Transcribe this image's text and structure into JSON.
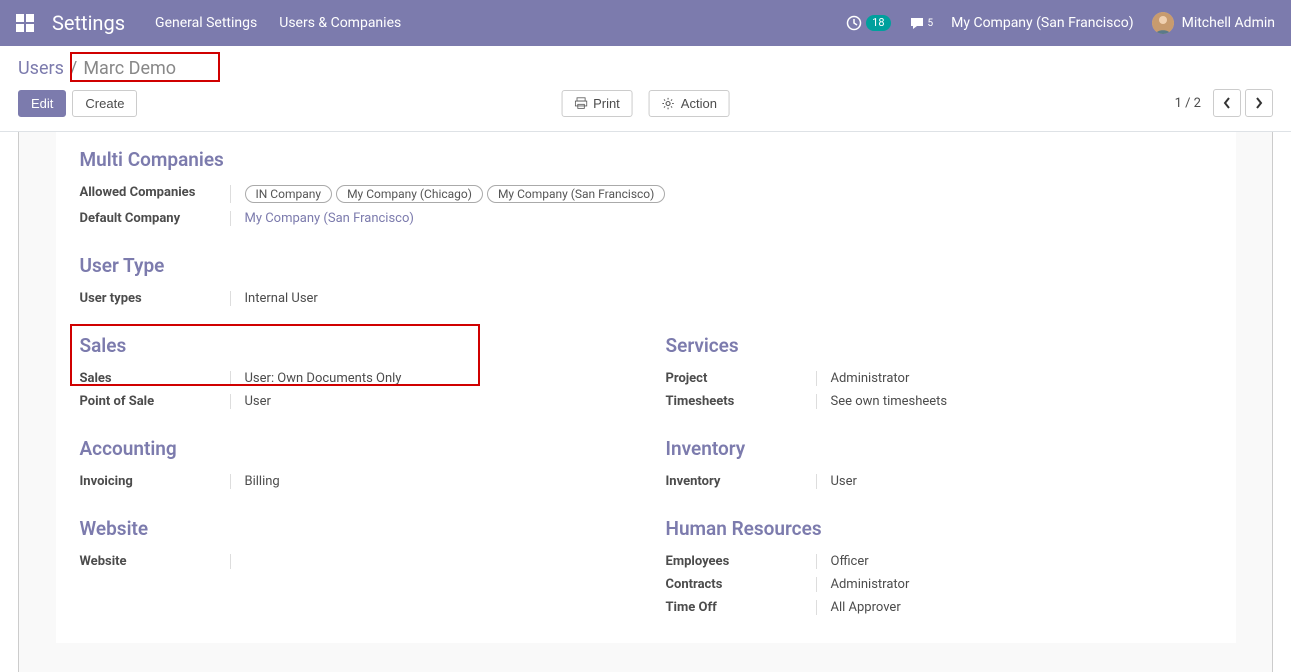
{
  "topnav": {
    "brand": "Settings",
    "links": {
      "general": "General Settings",
      "users": "Users & Companies"
    },
    "activity_count": "18",
    "message_count": "5",
    "company": "My Company (San Francisco)",
    "username": "Mitchell Admin"
  },
  "breadcrumb": {
    "root": "Users",
    "sep": "/",
    "current": "Marc Demo"
  },
  "controlbar": {
    "edit": "Edit",
    "create": "Create",
    "print": "Print",
    "action": "Action",
    "pager": "1 / 2"
  },
  "sections": {
    "multi_companies": {
      "title": "Multi Companies",
      "allowed_label": "Allowed Companies",
      "allowed_tags": [
        "IN Company",
        "My Company (Chicago)",
        "My Company (San Francisco)"
      ],
      "default_label": "Default Company",
      "default_value": "My Company (San Francisco)"
    },
    "user_type": {
      "title": "User Type",
      "types_label": "User types",
      "types_value": "Internal User"
    },
    "sales": {
      "title": "Sales",
      "sales_label": "Sales",
      "sales_value": "User: Own Documents Only",
      "pos_label": "Point of Sale",
      "pos_value": "User"
    },
    "services": {
      "title": "Services",
      "project_label": "Project",
      "project_value": "Administrator",
      "timesheets_label": "Timesheets",
      "timesheets_value": "See own timesheets"
    },
    "accounting": {
      "title": "Accounting",
      "invoicing_label": "Invoicing",
      "invoicing_value": "Billing"
    },
    "inventory": {
      "title": "Inventory",
      "inventory_label": "Inventory",
      "inventory_value": "User"
    },
    "website": {
      "title": "Website",
      "website_label": "Website",
      "website_value": ""
    },
    "hr": {
      "title": "Human Resources",
      "employees_label": "Employees",
      "employees_value": "Officer",
      "contracts_label": "Contracts",
      "contracts_value": "Administrator",
      "timeoff_label": "Time Off",
      "timeoff_value": "All Approver"
    }
  }
}
